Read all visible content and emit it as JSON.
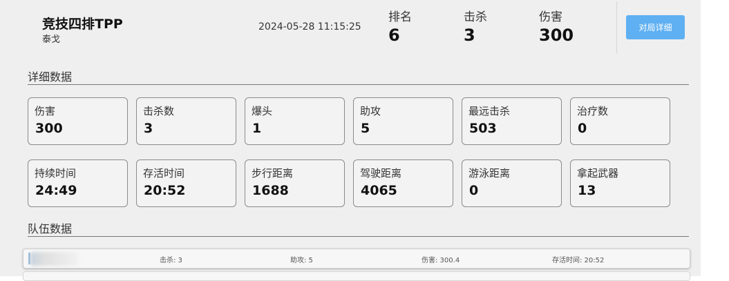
{
  "header": {
    "match_title": "竞技四排TPP",
    "map_name": "泰戈",
    "match_time": "2024-05-28 11:15:25",
    "stats": [
      {
        "label": "排名",
        "value": "6"
      },
      {
        "label": "击杀",
        "value": "3"
      },
      {
        "label": "伤害",
        "value": "300"
      }
    ],
    "detail_button": "对局详细"
  },
  "details": {
    "title": "详细数据",
    "cards": [
      {
        "label": "伤害",
        "value": "300"
      },
      {
        "label": "击杀数",
        "value": "3"
      },
      {
        "label": "爆头",
        "value": "1"
      },
      {
        "label": "助攻",
        "value": "5"
      },
      {
        "label": "最远击杀",
        "value": "503"
      },
      {
        "label": "治疗数",
        "value": "0"
      },
      {
        "label": "持续时间",
        "value": "24:49"
      },
      {
        "label": "存活时间",
        "value": "20:52"
      },
      {
        "label": "步行距离",
        "value": "1688"
      },
      {
        "label": "驾驶距离",
        "value": "4065"
      },
      {
        "label": "游泳距离",
        "value": "0"
      },
      {
        "label": "拿起武器",
        "value": "13"
      }
    ]
  },
  "team": {
    "title": "队伍数据",
    "rows": [
      {
        "kills": "击杀: 3",
        "assists": "助攻: 5",
        "damage": "伤害: 300.4",
        "survival": "存活时间: 20:52"
      }
    ]
  },
  "colors": {
    "accent_button": "#5fb0f2",
    "panel_bg": "#efefef"
  }
}
